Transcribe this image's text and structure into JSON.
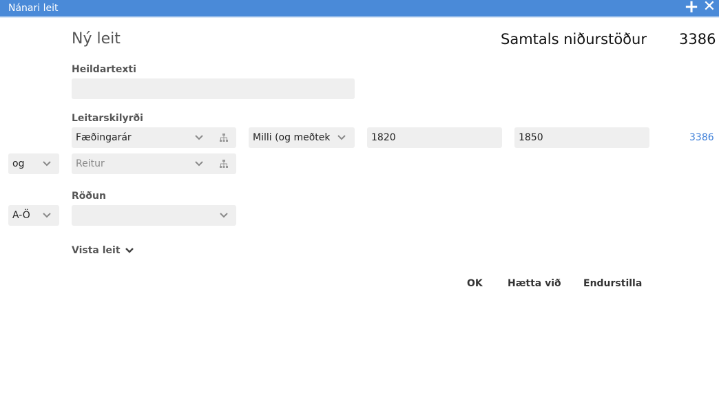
{
  "window": {
    "title": "Nánari leit",
    "add_icon": "plus-icon",
    "close_icon": "close-icon"
  },
  "header": {
    "page_title": "Ný leit",
    "total_label": "Samtals niðurstöður",
    "total_value": "3386"
  },
  "full_text": {
    "label": "Heildartexti",
    "value": "",
    "placeholder": ""
  },
  "criteria": {
    "label": "Leitarskilyrði",
    "rows": [
      {
        "connector": "",
        "field": "Fæðingarár",
        "operator": "Milli (og meðtek",
        "value_from": "1820",
        "value_to": "1850",
        "count": "3386"
      },
      {
        "connector": "og",
        "field": "Reitur",
        "field_is_placeholder": true
      }
    ]
  },
  "sorting": {
    "label": "Röðun",
    "order": "A-Ö",
    "field": ""
  },
  "save_search": {
    "label": "Vista leit"
  },
  "actions": {
    "ok": "OK",
    "cancel": "Hætta við",
    "reset": "Endurstilla"
  },
  "colors": {
    "titlebar": "#4a8ad8",
    "link": "#3b7dd8",
    "field_bg": "#efefef"
  }
}
